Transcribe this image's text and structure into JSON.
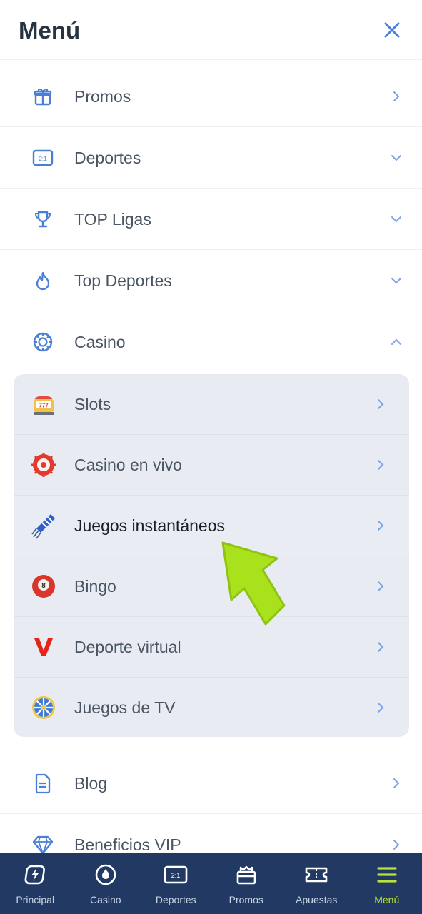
{
  "header": {
    "title": "Menú"
  },
  "menu": {
    "items": [
      {
        "label": "Promos",
        "icon": "gift-icon",
        "chevron": "right"
      },
      {
        "label": "Deportes",
        "icon": "scoreboard-icon",
        "chevron": "down"
      },
      {
        "label": "TOP Ligas",
        "icon": "trophy-icon",
        "chevron": "down"
      },
      {
        "label": "Top Deportes",
        "icon": "flame-icon",
        "chevron": "down"
      },
      {
        "label": "Casino",
        "icon": "casino-chip-icon",
        "chevron": "up"
      }
    ],
    "casino_sub": [
      {
        "label": "Slots",
        "icon": "slot-machine-icon"
      },
      {
        "label": "Casino en vivo",
        "icon": "roulette-icon"
      },
      {
        "label": "Juegos instantáneos",
        "icon": "rocket-icon"
      },
      {
        "label": "Bingo",
        "icon": "bingo-ball-icon"
      },
      {
        "label": "Deporte virtual",
        "icon": "v-logo-icon"
      },
      {
        "label": "Juegos de TV",
        "icon": "wheel-icon"
      }
    ],
    "after": [
      {
        "label": "Blog",
        "icon": "document-icon"
      },
      {
        "label": "Beneficios VIP",
        "icon": "diamond-icon"
      }
    ]
  },
  "tabbar": [
    {
      "label": "Principal",
      "icon": "lightning-icon"
    },
    {
      "label": "Casino",
      "icon": "casino-chip-icon"
    },
    {
      "label": "Deportes",
      "icon": "scoreboard-icon"
    },
    {
      "label": "Promos",
      "icon": "gift-box-icon"
    },
    {
      "label": "Apuestas",
      "icon": "ticket-icon"
    },
    {
      "label": "Menú",
      "icon": "hamburger-icon"
    }
  ],
  "colors": {
    "accent": "#4a7fd6",
    "tabbar": "#223a63",
    "active_tab": "#b6e23a",
    "arrow": "#a9e21d"
  }
}
